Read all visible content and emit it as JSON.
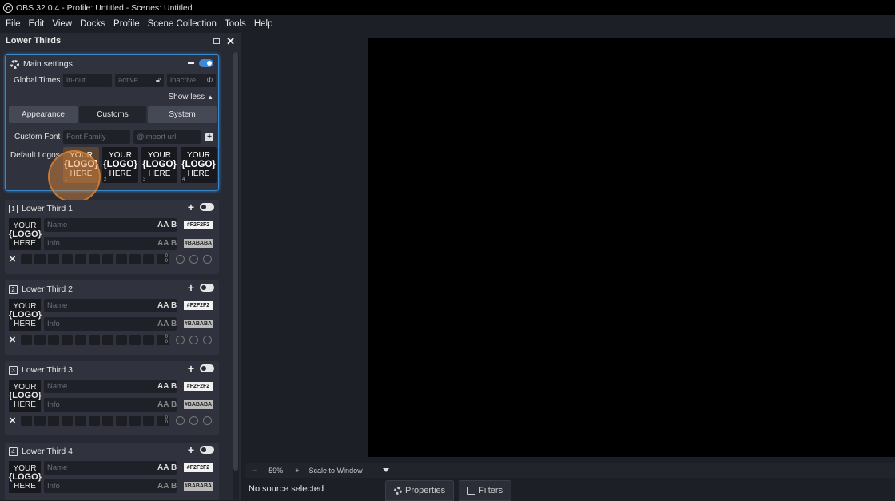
{
  "window": {
    "title": "OBS 32.0.4 - Profile: Untitled - Scenes: Untitled"
  },
  "menu": [
    "File",
    "Edit",
    "View",
    "Docks",
    "Profile",
    "Scene Collection",
    "Tools",
    "Help"
  ],
  "dock": {
    "title": "Lower Thirds",
    "main_settings": {
      "title": "Main settings",
      "global_times_label": "Global Times",
      "in_out_placeholder": "in-out",
      "active_placeholder": "active",
      "inactive_placeholder": "inactive",
      "show_less": "Show less",
      "tabs": [
        "Appearance",
        "Customs",
        "System"
      ],
      "active_tab": "Customs",
      "custom_font_label": "Custom Font",
      "font_family_placeholder": "Font Family",
      "import_placeholder": "@import url",
      "default_logos_label": "Default Logos",
      "logos": [
        {
          "l1": "YOUR",
          "l2": "{LOGO}",
          "l3": "HERE",
          "num": "1"
        },
        {
          "l1": "YOUR",
          "l2": "{LOGO}",
          "l3": "HERE",
          "num": "2"
        },
        {
          "l1": "YOUR",
          "l2": "{LOGO}",
          "l3": "HERE",
          "num": "3"
        },
        {
          "l1": "YOUR",
          "l2": "{LOGO}",
          "l3": "HERE",
          "num": "4"
        }
      ]
    },
    "lower_thirds": [
      {
        "num": "1",
        "title": "Lower Third 1",
        "name_placeholder": "Name",
        "info_placeholder": "Info",
        "name_color": "#F2F2F2",
        "info_color": "#BABABA",
        "logo_l1": "YOUR",
        "logo_l2": "{LOGO}",
        "logo_l3": "HERE"
      },
      {
        "num": "2",
        "title": "Lower Third 2",
        "name_placeholder": "Name",
        "info_placeholder": "Info",
        "name_color": "#F2F2F2",
        "info_color": "#BABABA",
        "logo_l1": "YOUR",
        "logo_l2": "{LOGO}",
        "logo_l3": "HERE"
      },
      {
        "num": "3",
        "title": "Lower Third 3",
        "name_placeholder": "Name",
        "info_placeholder": "Info",
        "name_color": "#F2F2F2",
        "info_color": "#BABABA",
        "logo_l1": "YOUR",
        "logo_l2": "{LOGO}",
        "logo_l3": "HERE"
      },
      {
        "num": "4",
        "title": "Lower Third 4",
        "name_placeholder": "Name",
        "info_placeholder": "Info",
        "name_color": "#F2F2F2",
        "info_color": "#BABABA",
        "logo_l1": "YOUR",
        "logo_l2": "{LOGO}",
        "logo_l3": "HERE"
      }
    ],
    "font_icon": "AA",
    "bold_icon": "B",
    "counter_top": "0",
    "counter_bottom": "0"
  },
  "preview": {
    "zoom": "59%",
    "scale_mode": "Scale to Window",
    "minus": "−",
    "plus": "+"
  },
  "bottom": {
    "status": "No source selected",
    "properties": "Properties",
    "filters": "Filters"
  }
}
